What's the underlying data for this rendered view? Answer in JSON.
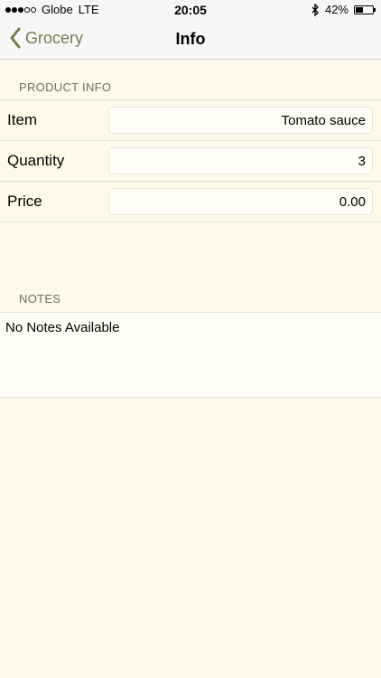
{
  "status_bar": {
    "carrier": "Globe",
    "network": "LTE",
    "time": "20:05",
    "battery_percent": "42%",
    "battery_level": 0.42,
    "signal_bars_filled": 3,
    "signal_bars_total": 5
  },
  "nav": {
    "back_label": "Grocery",
    "title": "Info"
  },
  "product_info": {
    "header": "PRODUCT INFO",
    "rows": [
      {
        "label": "Item",
        "value": "Tomato sauce"
      },
      {
        "label": "Quantity",
        "value": "3"
      },
      {
        "label": "Price",
        "value": "0.00"
      }
    ]
  },
  "notes": {
    "header": "NOTES",
    "text": "No Notes Available"
  },
  "colors": {
    "background": "#fdfae9",
    "accent": "#7c7a55"
  },
  "icons": {
    "back": "chevron-left-icon",
    "bluetooth": "bluetooth-icon",
    "battery": "battery-icon"
  }
}
